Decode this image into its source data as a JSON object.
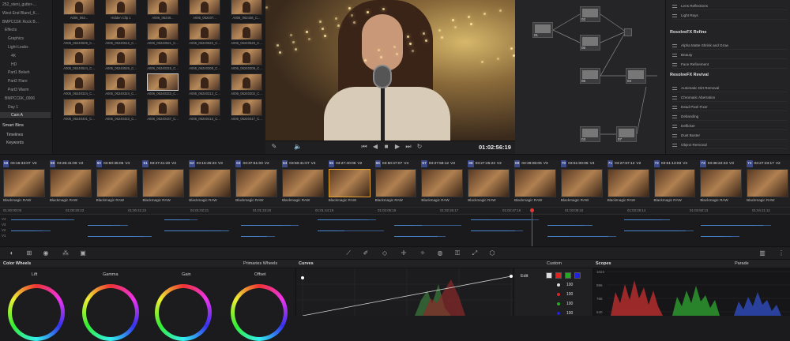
{
  "media_pool": {
    "items": [
      {
        "label": "252_steni_gutter-...",
        "sel": false
      },
      {
        "label": "West End Bland_K...",
        "sel": false
      },
      {
        "label": "BMPCC6K Rock B...",
        "sel": false
      },
      {
        "label": "Effects",
        "sel": false
      },
      {
        "label": "Graphics",
        "sel": false
      },
      {
        "label": "Light Leaks",
        "sel": false
      },
      {
        "label": "4K",
        "sel": false
      },
      {
        "label": "HD",
        "sel": false
      },
      {
        "label": "Part1 Bokeh",
        "sel": false
      },
      {
        "label": "Part2 Flare",
        "sel": false
      },
      {
        "label": "Part3 Warm",
        "sel": false
      },
      {
        "label": "BMPCC6K_0906",
        "sel": false
      },
      {
        "label": "Day 1",
        "sel": false
      },
      {
        "label": "Cam A",
        "sel": true
      }
    ],
    "smart_bins_label": "Smart Bins",
    "smart_bins": [
      "Timelines",
      "Keywords"
    ]
  },
  "thumbs": [
    [
      "A006_062...",
      "Hidden Clip 1",
      "A006_06240...",
      "A006_062407...",
      "A006_062436_C..."
    ],
    [
      "A006_06240509_C...",
      "A006_06240512_C...",
      "A006_06240521_C...",
      "A006_06240522_C...",
      "A006_06240529_C..."
    ],
    [
      "A006_06240524_C...",
      "A006_06240526_C...",
      "A006_06240315_C...",
      "A006_06240308_C...",
      "A006_06240309_C..."
    ],
    [
      "A006_06240324_C...",
      "A006_06240324_C...",
      "A006_06240333_C...",
      "A006_06240313_C...",
      "A006_06240302_C..."
    ],
    [
      "A006_06240401_C...",
      "A006_06240423_C...",
      "A006_06240437_C...",
      "A006_06240413_C...",
      "A006_06240417_C..."
    ]
  ],
  "viewer": {
    "timecode": "01:02:56:19"
  },
  "nodes": [
    {
      "label": "01"
    },
    {
      "label": "02"
    },
    {
      "label": "05"
    },
    {
      "label": "06"
    },
    {
      "label": "04"
    },
    {
      "label": "03"
    },
    {
      "label": "07"
    }
  ],
  "resolvefx": {
    "top_items": [
      "Lens Reflections",
      "Light Rays"
    ],
    "refine_label": "ResolveFX Refine",
    "refine_items": [
      "Alpha Matte Shrink and Grow",
      "Beauty",
      "Face Refinement"
    ],
    "revival_label": "ResolveFX Revival",
    "revival_items": [
      "Automatic Dirt Removal",
      "Chromatic Aberration",
      "Dead Pixel Fixer",
      "Debanding",
      "Deflicker",
      "Dust Buster",
      "Object Removal"
    ]
  },
  "clips": [
    {
      "num": "58",
      "tc": "03:16:33:07",
      "track": "V2",
      "label": "Blackmagic RAW"
    },
    {
      "num": "59",
      "tc": "03:26:41:09",
      "track": "V2",
      "label": "Blackmagic RAW"
    },
    {
      "num": "60",
      "tc": "03:50:35:05",
      "track": "V4",
      "label": "Blackmagic RAW"
    },
    {
      "num": "61",
      "tc": "03:27:41:20",
      "track": "V2",
      "label": "Blackmagic RAW"
    },
    {
      "num": "62",
      "tc": "03:16:46:23",
      "track": "V3",
      "label": "Blackmagic RAW"
    },
    {
      "num": "63",
      "tc": "03:37:51:03",
      "track": "V2",
      "label": "Blackmagic RAW"
    },
    {
      "num": "64",
      "tc": "03:50:41:07",
      "track": "V4",
      "label": "Blackmagic RAW"
    },
    {
      "num": "65",
      "tc": "03:27:40:06",
      "track": "V2",
      "label": "Blackmagic RAW"
    },
    {
      "num": "66",
      "tc": "03:50:47:07",
      "track": "V4",
      "label": "Blackmagic RAW"
    },
    {
      "num": "67",
      "tc": "03:37:58:12",
      "track": "V3",
      "label": "Blackmagic RAW"
    },
    {
      "num": "68",
      "tc": "03:27:45:23",
      "track": "V2",
      "label": "Blackmagic RAW"
    },
    {
      "num": "69",
      "tc": "03:38:06:05",
      "track": "V3",
      "label": "Blackmagic RAW"
    },
    {
      "num": "70",
      "tc": "03:51:00:05",
      "track": "V4",
      "label": "Blackmagic RAW"
    },
    {
      "num": "71",
      "tc": "03:27:57:12",
      "track": "V2",
      "label": "Blackmagic RAW"
    },
    {
      "num": "72",
      "tc": "03:51:13:03",
      "track": "V4",
      "label": "Blackmagic RAW"
    },
    {
      "num": "73",
      "tc": "03:38:22:23",
      "track": "V3",
      "label": "Blackmagic RAW"
    },
    {
      "num": "74",
      "tc": "03:27:23:17",
      "track": "V2",
      "label": "Blackmagic RAW"
    }
  ],
  "ruler": [
    "01:00:00:00",
    "01:00:20:23",
    "01:00:41:22",
    "01:01:02:21",
    "01:01:23:20",
    "01:01:44:19",
    "01:02:05:18",
    "01:02:26:17",
    "01:02:47:16",
    "01:03:08:15",
    "01:03:29:14",
    "01:03:50:13",
    "01:04:11:12"
  ],
  "track_labels": [
    "V4",
    "V3",
    "V2",
    "V1"
  ],
  "panels": {
    "color_wheels": "Color Wheels",
    "primaries_mode": "Primaries Wheels",
    "curves": "Curves",
    "curves_mode": "Custom",
    "scopes": "Scopes",
    "scopes_mode": "Parade",
    "edit": "Edit"
  },
  "wheels": [
    "Lift",
    "Gamma",
    "Gain",
    "Offset"
  ],
  "edit_values": [
    "100",
    "100",
    "100",
    "100"
  ],
  "scope_ticks": [
    "1023",
    "896",
    "768",
    "640"
  ],
  "colors": {
    "accent": "#3d4a8a",
    "selection": "#e0a030",
    "timeline": "#4a8ad8"
  }
}
